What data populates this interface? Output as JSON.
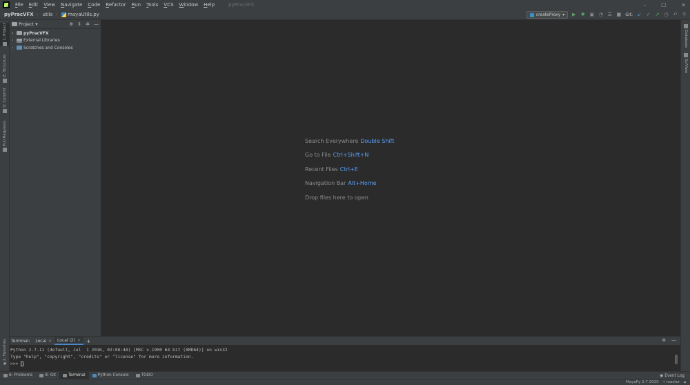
{
  "menu": {
    "items": [
      {
        "label": "File",
        "mnemonic": "F",
        "rest": "ile"
      },
      {
        "label": "Edit",
        "mnemonic": "E",
        "rest": "dit"
      },
      {
        "label": "View",
        "mnemonic": "V",
        "rest": "iew"
      },
      {
        "label": "Navigate",
        "mnemonic": "N",
        "rest": "avigate"
      },
      {
        "label": "Code",
        "mnemonic": "C",
        "rest": "ode"
      },
      {
        "label": "Refactor",
        "mnemonic": "R",
        "rest": "efactor"
      },
      {
        "label": "Run",
        "mnemonic": "R",
        "rest": "un"
      },
      {
        "label": "Tools",
        "mnemonic": "T",
        "rest": "ools"
      },
      {
        "label": "VCS",
        "mnemonic": "V",
        "rest": "CS"
      },
      {
        "label": "Window",
        "mnemonic": "W",
        "rest": "indow"
      },
      {
        "label": "Help",
        "mnemonic": "H",
        "rest": "elp"
      }
    ],
    "window_title": "pyPracVFX"
  },
  "breadcrumb": {
    "project": "pyPracVFX",
    "folder": "utils",
    "file": "mayaUtils.py"
  },
  "toolbar": {
    "run_config": "createProxy",
    "git_label": "Git:"
  },
  "left_stripe": {
    "tabs": [
      {
        "label": "1: Project",
        "active": true
      },
      {
        "label": "Z: Structure",
        "active": false
      },
      {
        "label": "0: Commit",
        "active": false
      },
      {
        "label": "Pull Requests",
        "active": false
      },
      {
        "label": "2: Favorites",
        "active": false
      }
    ]
  },
  "right_stripe": {
    "tabs": [
      {
        "label": "Database"
      },
      {
        "label": "SciView"
      }
    ]
  },
  "project_panel": {
    "title": "Project",
    "tree": [
      {
        "label": "pyPracVFX",
        "icon": "folder",
        "bold": true
      },
      {
        "label": "External Libraries",
        "icon": "lib",
        "bold": false
      },
      {
        "label": "Scratches and Consoles",
        "icon": "scratch",
        "bold": false
      }
    ]
  },
  "editor": {
    "hints": [
      {
        "label": "Search Everywhere",
        "key": "Double Shift"
      },
      {
        "label": "Go to File",
        "key": "Ctrl+Shift+N"
      },
      {
        "label": "Recent Files",
        "key": "Ctrl+E"
      },
      {
        "label": "Navigation Bar",
        "key": "Alt+Home"
      },
      {
        "label": "Drop files here to open",
        "key": ""
      }
    ]
  },
  "terminal": {
    "label": "Terminal:",
    "tabs": [
      {
        "label": "Local",
        "active": false
      },
      {
        "label": "Local (2)",
        "active": true
      }
    ],
    "lines": [
      "Python 2.7.11 (default, Jul  1 2016, 02:08:48) [MSC v.1900 64 bit (AMD64)] on win32",
      "Type \"help\", \"copyright\", \"credits\" or \"license\" for more information.",
      ">>> "
    ]
  },
  "bottom_bar": {
    "tabs": [
      {
        "label": "6: Problems",
        "active": false
      },
      {
        "label": "9: Git",
        "active": false
      },
      {
        "label": "Terminal",
        "active": true
      },
      {
        "label": "Python Console",
        "active": false
      },
      {
        "label": "TODO",
        "active": false
      }
    ],
    "event_log": "Event Log"
  },
  "status_bar": {
    "interpreter": "MayaPy 2.7 2020",
    "branch": "master"
  }
}
